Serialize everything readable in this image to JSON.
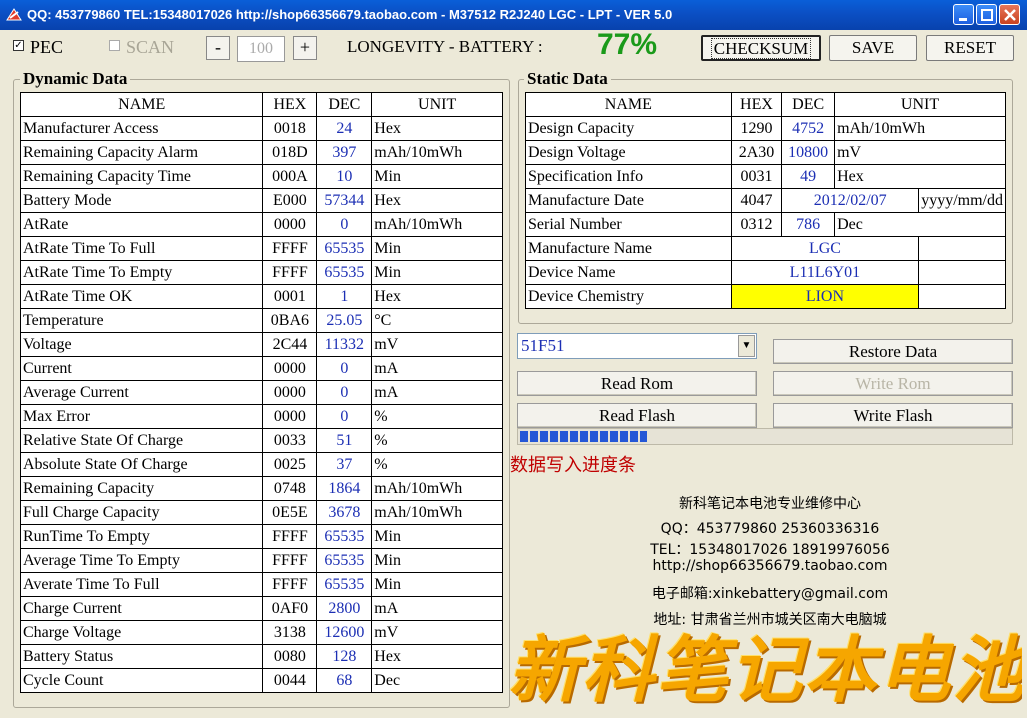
{
  "window": {
    "title": "QQ: 453779860 TEL:15348017026 http://shop66356679.taobao.com - M37512 R2J240 LGC - LPT - VER 5.0"
  },
  "top": {
    "pec_label": "PEC",
    "pec_checked": "✓",
    "scan_label": "SCAN",
    "minus_label": "-",
    "spin_value": "100",
    "plus_label": "+",
    "longevity_label": "LONGEVITY - BATTERY :",
    "longevity_value": "77%",
    "checksum_label": "CHECKSUM",
    "save_label": "SAVE",
    "reset_label": "RESET"
  },
  "dynamic": {
    "title": "Dynamic Data",
    "headers": [
      "NAME",
      "HEX",
      "DEC",
      "UNIT"
    ],
    "rows": [
      [
        "Manufacturer Access",
        "0018",
        "24",
        "Hex"
      ],
      [
        "Remaining Capacity Alarm",
        "018D",
        "397",
        "mAh/10mWh"
      ],
      [
        "Remaining Capacity Time",
        "000A",
        "10",
        "Min"
      ],
      [
        "Battery Mode",
        "E000",
        "57344",
        "Hex"
      ],
      [
        "AtRate",
        "0000",
        "0",
        "mAh/10mWh"
      ],
      [
        "AtRate Time To Full",
        "FFFF",
        "65535",
        "Min"
      ],
      [
        "AtRate Time To Empty",
        "FFFF",
        "65535",
        "Min"
      ],
      [
        "AtRate Time OK",
        "0001",
        "1",
        "Hex"
      ],
      [
        "Temperature",
        "0BA6",
        "25.05",
        "°C"
      ],
      [
        "Voltage",
        "2C44",
        "11332",
        "mV"
      ],
      [
        "Current",
        "0000",
        "0",
        "mA"
      ],
      [
        "Average Current",
        "0000",
        "0",
        "mA"
      ],
      [
        "Max Error",
        "0000",
        "0",
        "%"
      ],
      [
        "Relative State Of Charge",
        "0033",
        "51",
        "%"
      ],
      [
        "Absolute State Of Charge",
        "0025",
        "37",
        "%"
      ],
      [
        "Remaining Capacity",
        "0748",
        "1864",
        "mAh/10mWh"
      ],
      [
        "Full Charge Capacity",
        "0E5E",
        "3678",
        "mAh/10mWh"
      ],
      [
        "RunTime To Empty",
        "FFFF",
        "65535",
        "Min"
      ],
      [
        "Average Time To Empty",
        "FFFF",
        "65535",
        "Min"
      ],
      [
        "Averate Time To Full",
        "FFFF",
        "65535",
        "Min"
      ],
      [
        "Charge Current",
        "0AF0",
        "2800",
        "mA"
      ],
      [
        "Charge Voltage",
        "3138",
        "12600",
        "mV"
      ],
      [
        "Battery Status",
        "0080",
        "128",
        "Hex"
      ],
      [
        "Cycle Count",
        "0044",
        "68",
        "Dec"
      ]
    ]
  },
  "static": {
    "title": "Static Data",
    "headers": [
      "NAME",
      "HEX",
      "DEC",
      "UNIT"
    ],
    "rows": [
      [
        "Design Capacity",
        "1290",
        "4752",
        "mAh/10mWh"
      ],
      [
        "Design Voltage",
        "2A30",
        "10800",
        "mV"
      ],
      [
        "Specification Info",
        "0031",
        "49",
        "Hex"
      ],
      [
        "Manufacture Date",
        "4047",
        "2012/02/07",
        "yyyy/mm/dd"
      ],
      [
        "Serial Number",
        "0312",
        "786",
        "Dec"
      ]
    ],
    "string_rows": [
      [
        "Manufacture Name",
        "LGC"
      ],
      [
        "Device Name",
        "L11L6Y01"
      ],
      [
        "Device Chemistry",
        "LION"
      ]
    ]
  },
  "controls": {
    "combo_value": "51F51",
    "combo_arrow": "▼",
    "restore_data": "Restore Data",
    "read_rom": "Read Rom",
    "write_rom": "Write Rom",
    "read_flash": "Read Flash",
    "write_flash": "Write Flash",
    "progress_fraction": 0.26,
    "progress_caption": "数据写入进度条"
  },
  "info": {
    "line1": "新科笔记本电池专业维修中心",
    "line2": "QQ：453779860 25360336316",
    "line3": "TEL：15348017026 18919976056",
    "line4": "http://shop66356679.taobao.com",
    "line5": "电子邮箱:xinkebattery@gmail.com",
    "line6": "地址: 甘肃省兰州市城关区南大电脑城",
    "banner": "新科笔记本电池"
  }
}
